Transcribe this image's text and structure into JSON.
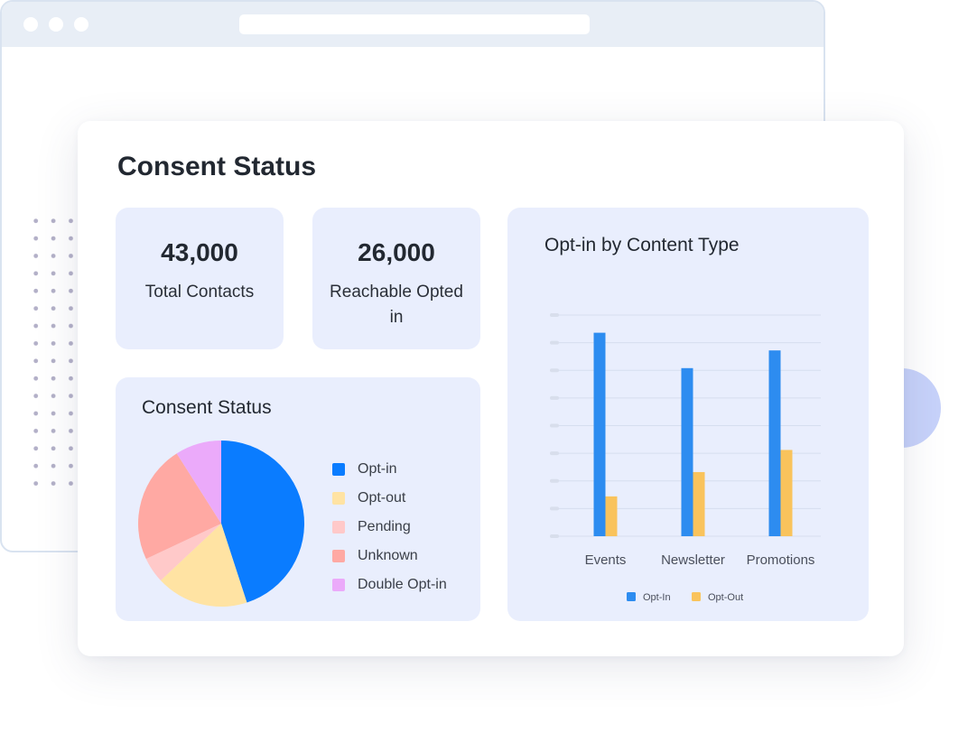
{
  "page": {
    "title": "Consent Status"
  },
  "stats": [
    {
      "value": "43,000",
      "label": "Total Contacts"
    },
    {
      "value": "26,000",
      "label": "Reachable Opted in"
    }
  ],
  "colors": {
    "card_bg": "#ffffff",
    "panel_bg": "#e9eefd",
    "opt_in_blue": "#0a7cff",
    "opt_out_yellow": "#f9c35c",
    "bar_blue": "#2d8cf0"
  },
  "chart_data": [
    {
      "type": "pie",
      "title": "Consent Status",
      "labels": [
        "Opt-in",
        "Opt-out",
        "Pending",
        "Unknown",
        "Double Opt-in"
      ],
      "values": [
        45,
        18,
        5,
        23,
        9
      ],
      "colors": [
        "#0a7cff",
        "#ffe3a3",
        "#ffc9c9",
        "#ffa9a3",
        "#ebaafa"
      ],
      "legend": [
        "Opt-in",
        "Opt-out",
        "Pending",
        "Unknown",
        "Double Opt-in"
      ],
      "legend_position": "right"
    },
    {
      "type": "bar",
      "title": "Opt-in by Content Type",
      "categories": [
        "Events",
        "Newsletter",
        "Promotions"
      ],
      "series": [
        {
          "name": "Opt-In",
          "values": [
            92,
            76,
            84
          ],
          "color": "#2d8cf0"
        },
        {
          "name": "Opt-Out",
          "values": [
            18,
            29,
            39
          ],
          "color": "#f9c35c"
        }
      ],
      "ylim": [
        0,
        100
      ],
      "yticks": [
        0,
        12.5,
        25,
        37.5,
        50,
        62.5,
        75,
        87.5,
        100
      ],
      "tick_labels_visible": false,
      "grid": true,
      "legend_position": "bottom"
    }
  ]
}
